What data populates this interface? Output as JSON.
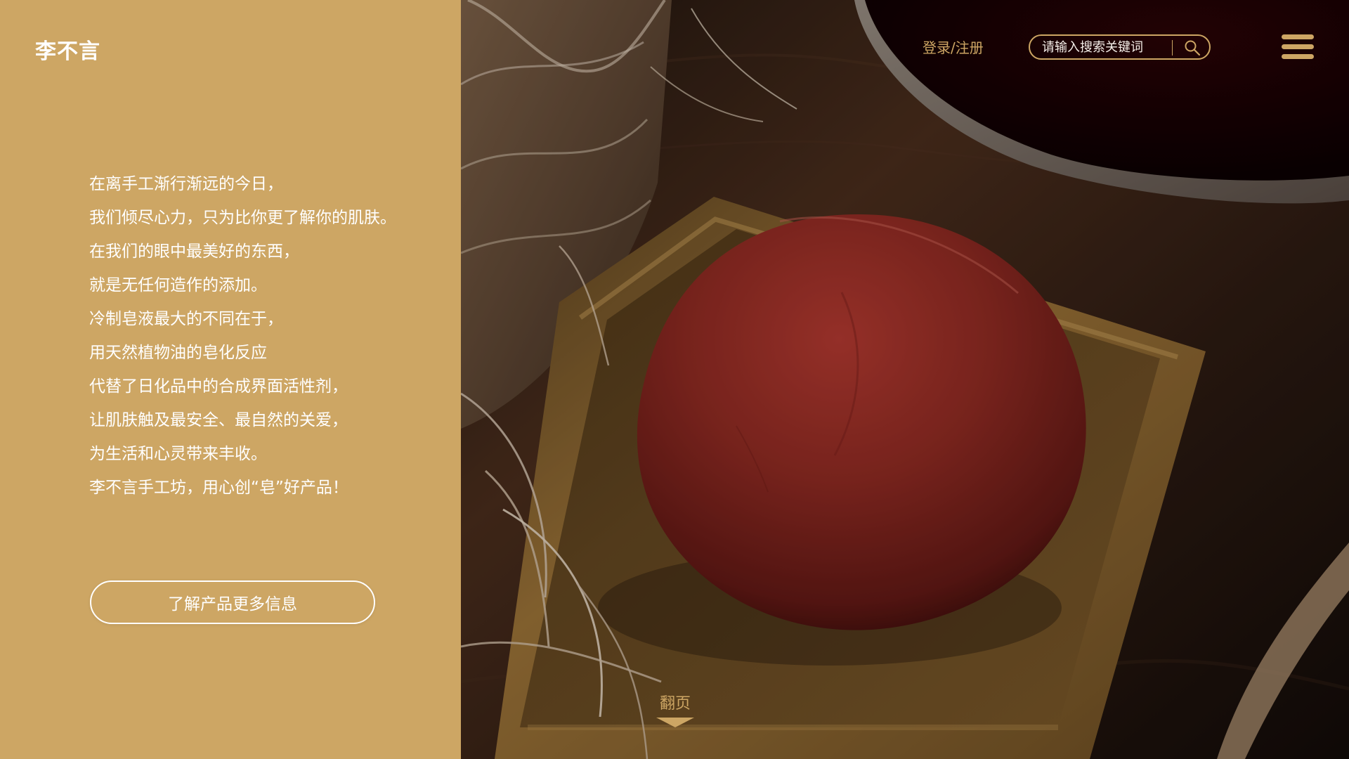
{
  "brand": {
    "logo_text": "李不言"
  },
  "header": {
    "login_label": "登录/注册",
    "search": {
      "placeholder": "请输入搜索关键词"
    }
  },
  "intro": {
    "lines": [
      "在离手工渐行渐远的今日，",
      "我们倾尽心力，只为比你更了解你的肌肤。",
      "在我们的眼中最美好的东西，",
      "就是无任何造作的添加。",
      "冷制皂液最大的不同在于，",
      "用天然植物油的皂化反应",
      "代替了日化品中的合成界面活性剂，",
      "让肌肤触及最安全、最自然的关爱，",
      "为生活和心灵带来丰收。",
      "李不言手工坊，用心创“皂”好产品！"
    ]
  },
  "cta": {
    "label": "了解产品更多信息"
  },
  "pager": {
    "label": "翻页"
  },
  "icons": {
    "search": "search-icon",
    "menu": "menu-icon",
    "page_turn": "chevron-down-icon"
  },
  "colors": {
    "panel": "#cda664",
    "accent": "#cda664",
    "text_on_panel": "#ffffff",
    "hero_dark": "#2a1a12"
  }
}
